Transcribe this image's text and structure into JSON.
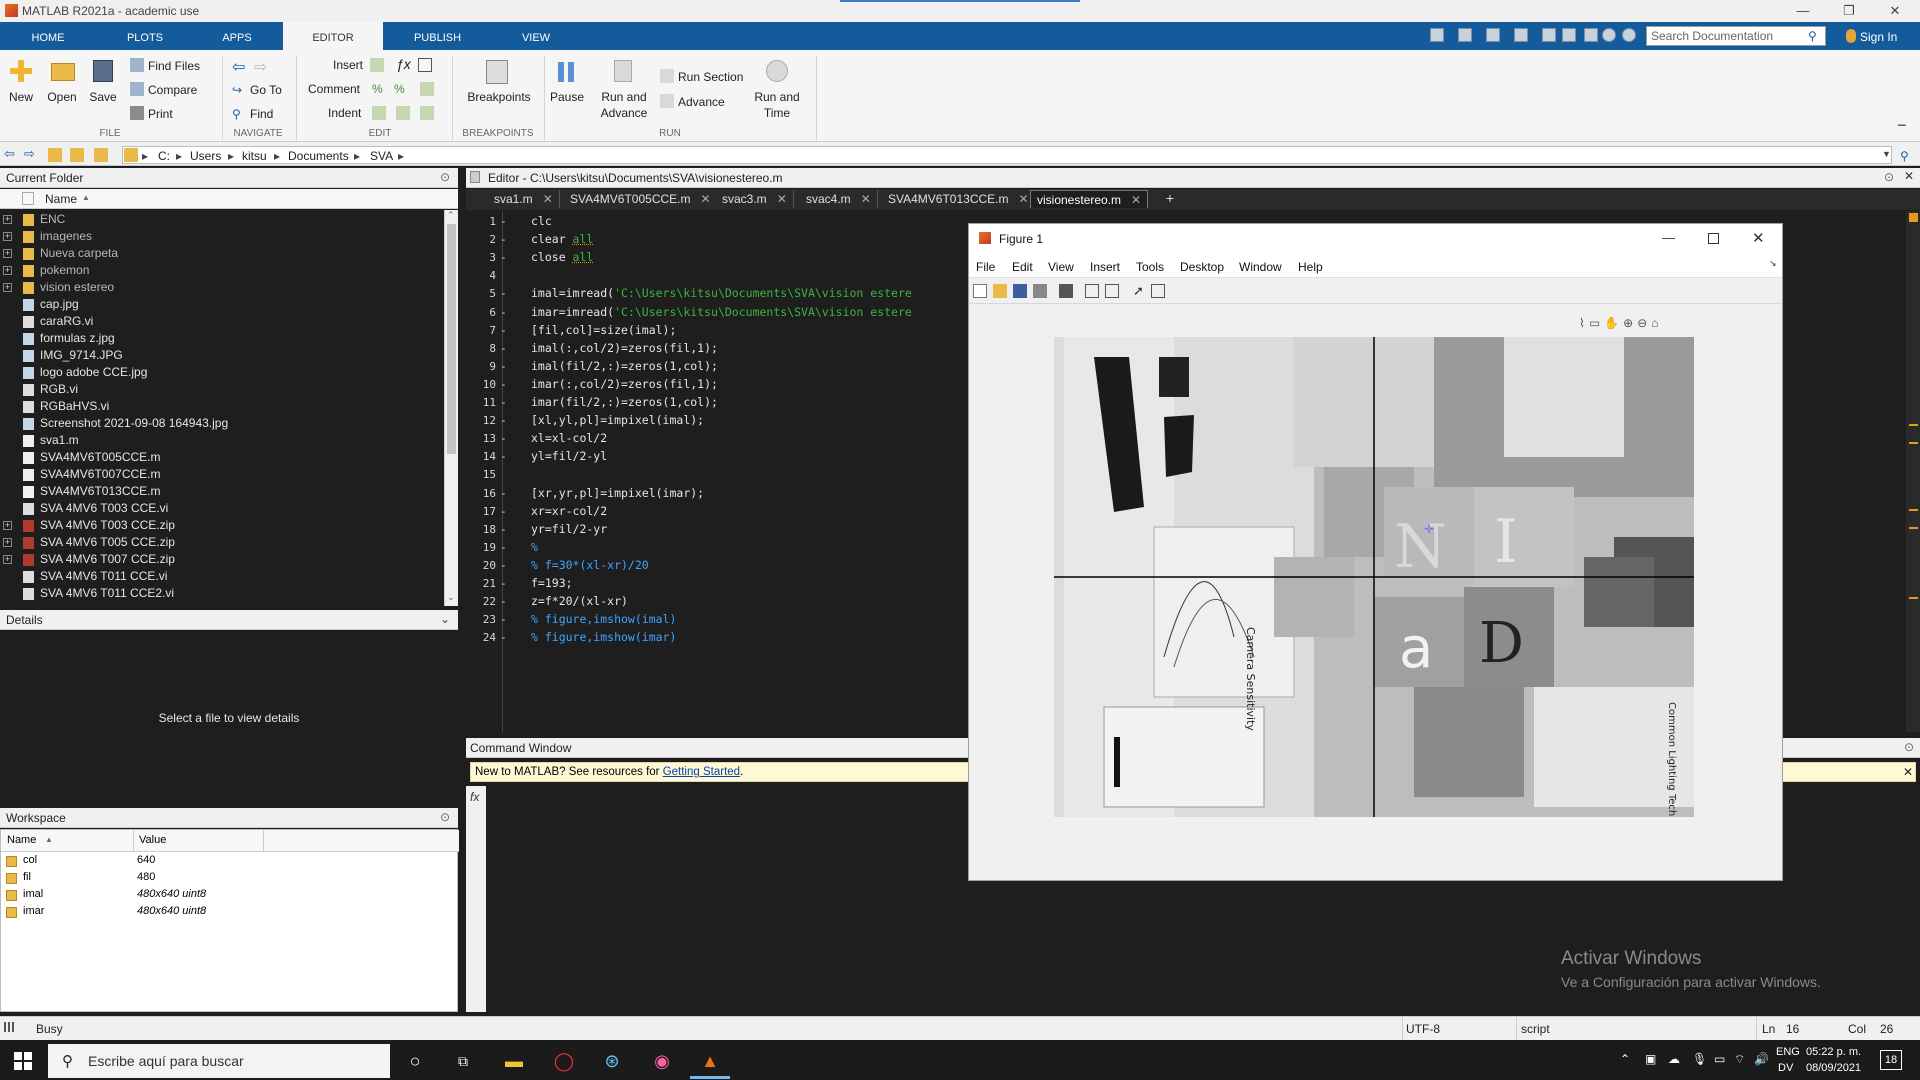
{
  "window": {
    "title": "MATLAB R2021a - academic use",
    "minimize": "—",
    "maximize": "❐",
    "close": "✕"
  },
  "tabs": [
    "HOME",
    "PLOTS",
    "APPS",
    "EDITOR",
    "PUBLISH",
    "VIEW"
  ],
  "search": {
    "placeholder": "Search Documentation"
  },
  "sign_in": "Sign In",
  "ribbon": {
    "file": {
      "new": "New",
      "open": "Open",
      "save": "Save",
      "find_files": "Find Files",
      "compare": "Compare",
      "print": "Print",
      "group": "FILE"
    },
    "navigate": {
      "goto": "Go To",
      "find": "Find",
      "group": "NAVIGATE"
    },
    "edit": {
      "insert": "Insert",
      "comment": "Comment",
      "indent": "Indent",
      "group": "EDIT"
    },
    "breakpoints": {
      "label": "Breakpoints",
      "group": "BREAKPOINTS"
    },
    "run": {
      "pause": "Pause",
      "run_advance_1": "Run and",
      "run_advance_2": "Advance",
      "run_section": "Run Section",
      "advance": "Advance",
      "run_time_1": "Run and",
      "run_time_2": "Time",
      "group": "RUN"
    }
  },
  "path": [
    "C:",
    "Users",
    "kitsu",
    "Documents",
    "SVA"
  ],
  "current_folder": {
    "title": "Current Folder",
    "name_header": "Name",
    "items": [
      {
        "name": "ENC",
        "type": "dir"
      },
      {
        "name": "imagenes",
        "type": "dir"
      },
      {
        "name": "Nueva carpeta",
        "type": "dir"
      },
      {
        "name": "pokemon",
        "type": "dir"
      },
      {
        "name": "vision estereo",
        "type": "dir"
      },
      {
        "name": "cap.jpg",
        "type": "img"
      },
      {
        "name": "caraRG.vi",
        "type": "vi"
      },
      {
        "name": "formulas z.jpg",
        "type": "img"
      },
      {
        "name": "IMG_9714.JPG",
        "type": "img"
      },
      {
        "name": "logo adobe CCE.jpg",
        "type": "img"
      },
      {
        "name": "RGB.vi",
        "type": "vi"
      },
      {
        "name": "RGBaHVS.vi",
        "type": "vi"
      },
      {
        "name": "Screenshot 2021-09-08 164943.jpg",
        "type": "img"
      },
      {
        "name": "sva1.m",
        "type": "m"
      },
      {
        "name": "SVA4MV6T005CCE.m",
        "type": "m"
      },
      {
        "name": "SVA4MV6T007CCE.m",
        "type": "m"
      },
      {
        "name": "SVA4MV6T013CCE.m",
        "type": "m"
      },
      {
        "name": "SVA 4MV6 T003 CCE.vi",
        "type": "vi"
      },
      {
        "name": "SVA 4MV6 T003 CCE.zip",
        "type": "zip"
      },
      {
        "name": "SVA 4MV6 T005 CCE.zip",
        "type": "zip"
      },
      {
        "name": "SVA 4MV6 T007 CCE.zip",
        "type": "zip"
      },
      {
        "name": "SVA 4MV6 T011 CCE.vi",
        "type": "vi"
      },
      {
        "name": "SVA 4MV6 T011 CCE2.vi",
        "type": "vi"
      }
    ]
  },
  "details": {
    "title": "Details",
    "message": "Select a file to view details"
  },
  "workspace": {
    "title": "Workspace",
    "col_name": "Name",
    "col_value": "Value",
    "rows": [
      {
        "name": "col",
        "value": "640"
      },
      {
        "name": "fil",
        "value": "480"
      },
      {
        "name": "imal",
        "value": "480x640 uint8"
      },
      {
        "name": "imar",
        "value": "480x640 uint8"
      }
    ]
  },
  "editor": {
    "title": "Editor - C:\\Users\\kitsu\\Documents\\SVA\\visionestereo.m",
    "tabs": [
      "sva1.m",
      "SVA4MV6T005CCE.m",
      "svac3.m",
      "svac4.m",
      "SVA4MV6T013CCE.m",
      "visionestereo.m"
    ],
    "lines": [
      "clc",
      "clear all",
      "close all",
      "",
      "imal=imread('C:\\Users\\kitsu\\Documents\\SVA\\vision estere",
      "imar=imread('C:\\Users\\kitsu\\Documents\\SVA\\vision estere",
      "[fil,col]=size(imal);",
      "imal(:,col/2)=zeros(fil,1);",
      "imal(fil/2,:)=zeros(1,col);",
      "imar(:,col/2)=zeros(fil,1);",
      "imar(fil/2,:)=zeros(1,col);",
      "[xl,yl,pl]=impixel(imal);",
      "xl=xl-col/2",
      "yl=fil/2-yl",
      "",
      "[xr,yr,pl]=impixel(imar);",
      "xr=xr-col/2",
      "yr=fil/2-yr",
      "%",
      "% f=30*(xl-xr)/20",
      "f=193;",
      "z=f*20/(xl-xr)",
      "% figure,imshow(imal)",
      "% figure,imshow(imar)"
    ]
  },
  "figure": {
    "title": "Figure 1",
    "menu": [
      "File",
      "Edit",
      "View",
      "Insert",
      "Tools",
      "Desktop",
      "Window",
      "Help"
    ],
    "image_text": [
      "Camera Sensitivity",
      "Common Lighting Techniques",
      "N",
      "I",
      "a",
      "D"
    ]
  },
  "command_window": {
    "title": "Command Window",
    "notice": "New to MATLAB? See resources for ",
    "link": "Getting Started",
    "dot": ".",
    "prompt": "fx"
  },
  "status": {
    "busy": "Busy",
    "encoding": "UTF-8",
    "mode": "script",
    "ln_label": "Ln",
    "ln": "16",
    "col_label": "Col",
    "col": "26"
  },
  "watermark": {
    "line1": "Activar Windows",
    "line2": "Ve a Configuración para activar Windows."
  },
  "taskbar": {
    "search": "Escribe aquí para buscar",
    "time": "05:22 p. m.",
    "date": "08/09/2021",
    "lang1": "ENG",
    "lang2": "DV",
    "notif": "18"
  }
}
